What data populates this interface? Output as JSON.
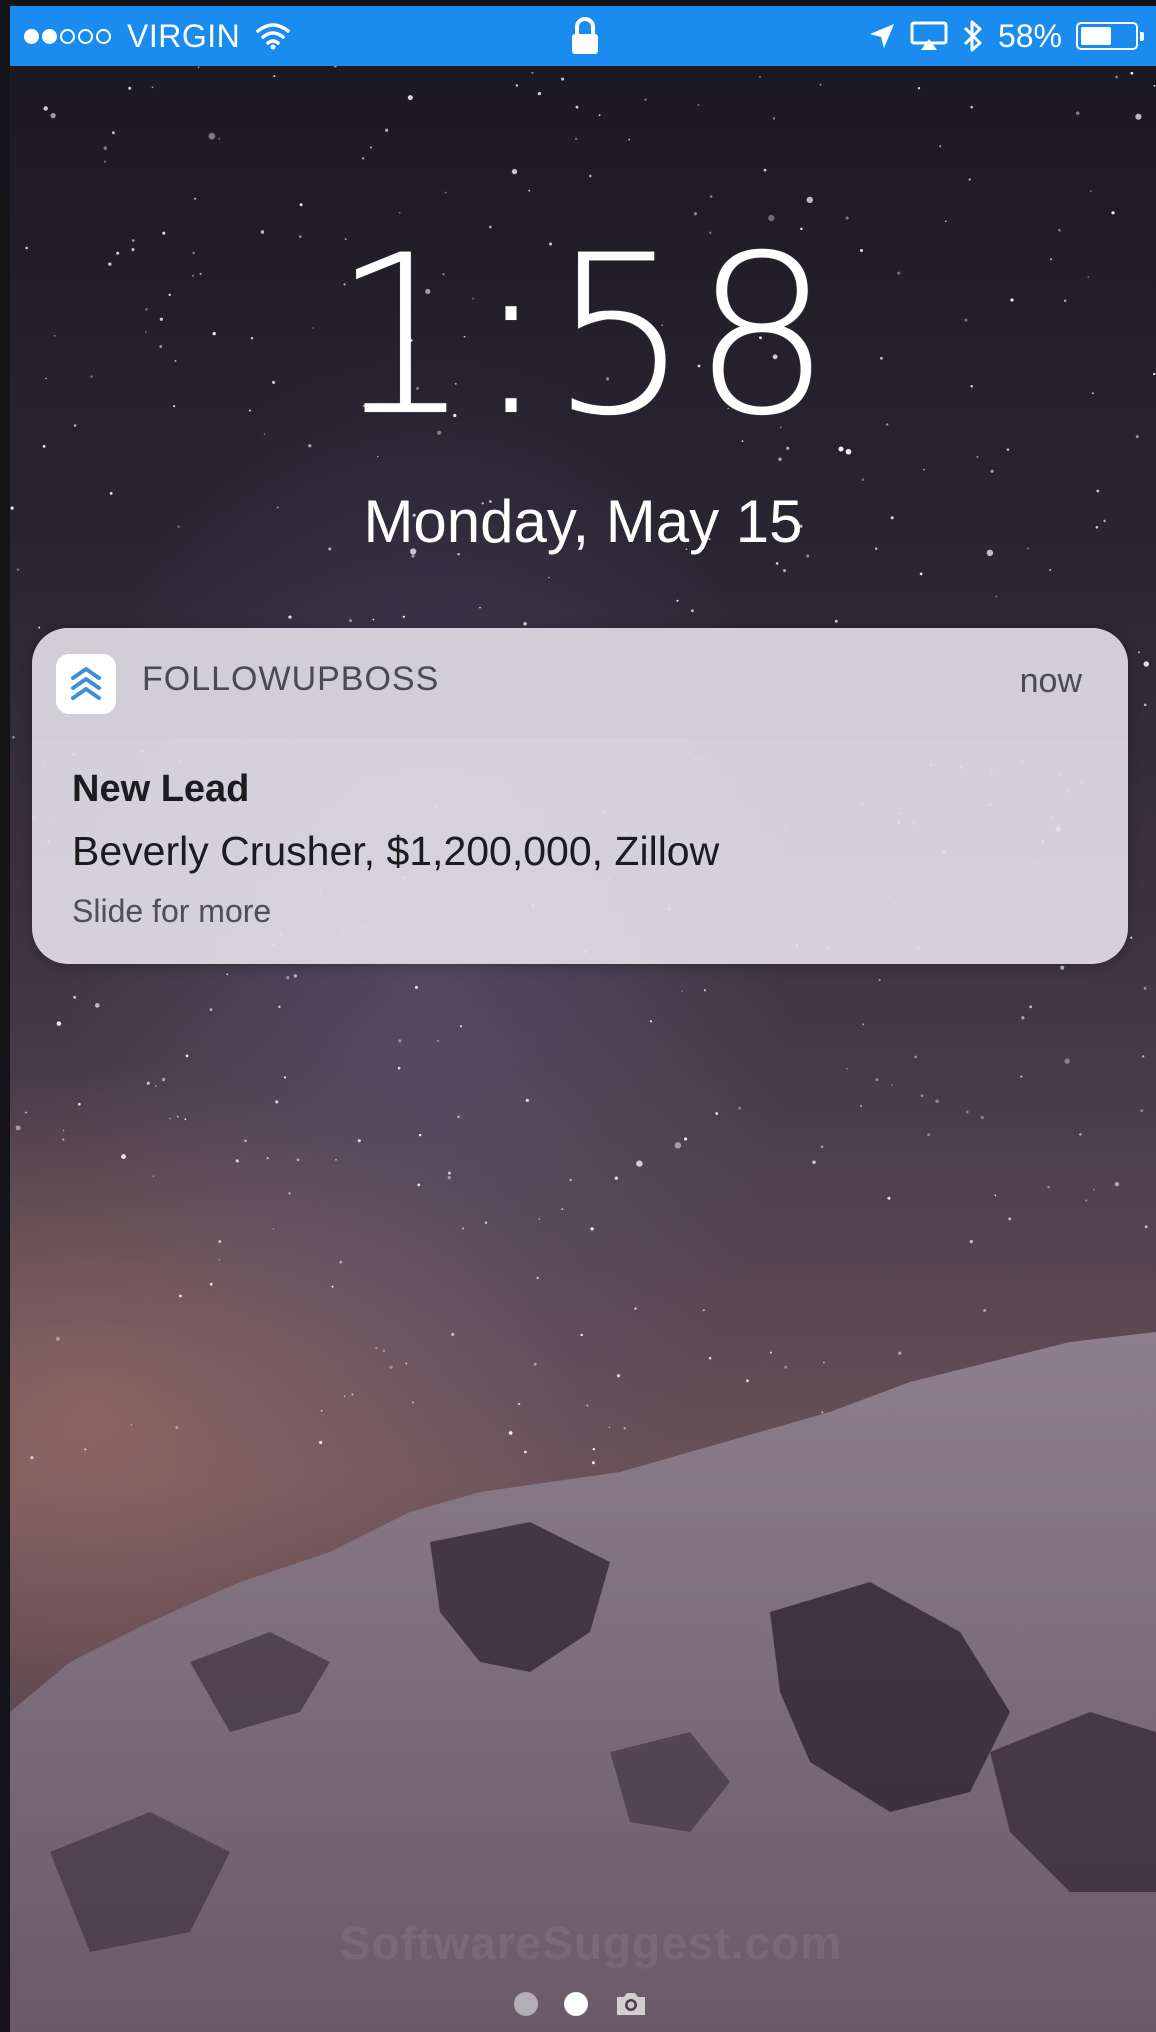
{
  "status_bar": {
    "signal_full": 2,
    "signal_total": 5,
    "carrier": "VIRGIN",
    "battery_percent_label": "58%",
    "battery_level": 0.58,
    "icons": [
      "wifi-icon",
      "lock-icon",
      "location-arrow-icon",
      "airplay-icon",
      "bluetooth-icon",
      "battery-icon"
    ],
    "accent_color": "#1a8cf0"
  },
  "lock_screen": {
    "time": "1:58",
    "date": "Monday, May 15"
  },
  "notification": {
    "app_name": "FOLLOWUPBOSS",
    "time": "now",
    "title": "New Lead",
    "body": "Beverly Crusher, $1,200,000, Zillow",
    "hint": "Slide for more",
    "app_icon": "chevrons-up-icon",
    "icon_color": "#3b8fd8"
  },
  "page_indicator": {
    "pages": 2,
    "active_index": 1,
    "extra_icon": "camera-icon"
  },
  "watermark": "SoftwareSuggest.com"
}
